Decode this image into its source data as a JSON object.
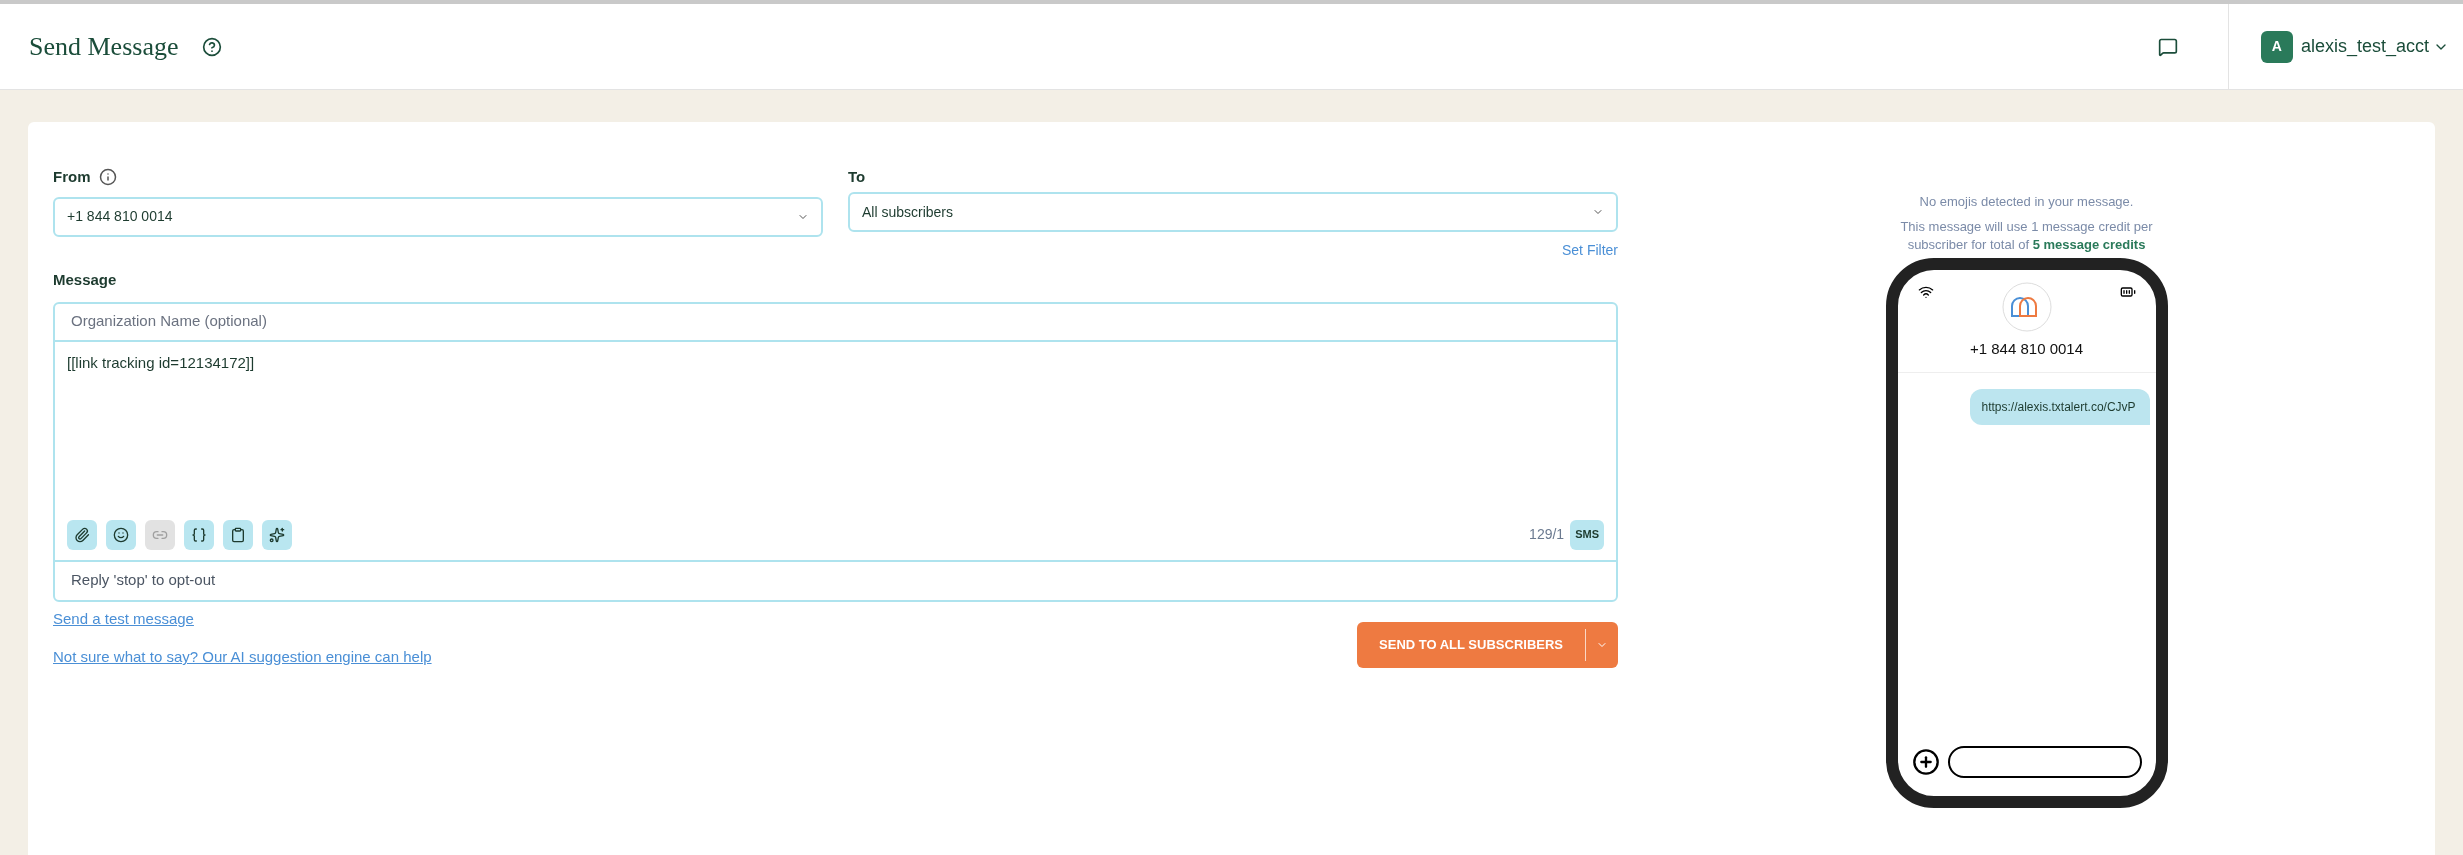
{
  "header": {
    "title": "Send Message",
    "account": {
      "initial": "A",
      "name": "alexis_test_acct"
    }
  },
  "form": {
    "from": {
      "label": "From",
      "value": "+1 844 810 0014"
    },
    "to": {
      "label": "To",
      "value": "All subscribers",
      "link": "Set Filter"
    },
    "message": {
      "label": "Message",
      "org_placeholder": "Organization Name (optional)",
      "body": "[[link tracking id=12134172]]",
      "counter": "129/1",
      "type_badge": "SMS",
      "footer": "Reply 'stop' to opt-out",
      "tools": [
        {
          "kind": "attach",
          "disabled": false
        },
        {
          "kind": "emoji",
          "disabled": false
        },
        {
          "kind": "link",
          "disabled": true
        },
        {
          "kind": "variables",
          "disabled": false
        },
        {
          "kind": "clipboard",
          "disabled": false
        },
        {
          "kind": "sparkle",
          "disabled": false
        }
      ]
    },
    "test_link": "Send a test message",
    "ai_link": "Not sure what to say? Our AI suggestion engine can help",
    "send_button": "SEND TO ALL SUBSCRIBERS"
  },
  "preview": {
    "emoji_note": "No emojis detected in your message.",
    "credit_note": "This message will use 1 message credit per subscriber for total of **5 message credits**",
    "phone_number": "+1 844 810 0014",
    "bubble": "https://alexis.txtalert.co/CJvP"
  }
}
